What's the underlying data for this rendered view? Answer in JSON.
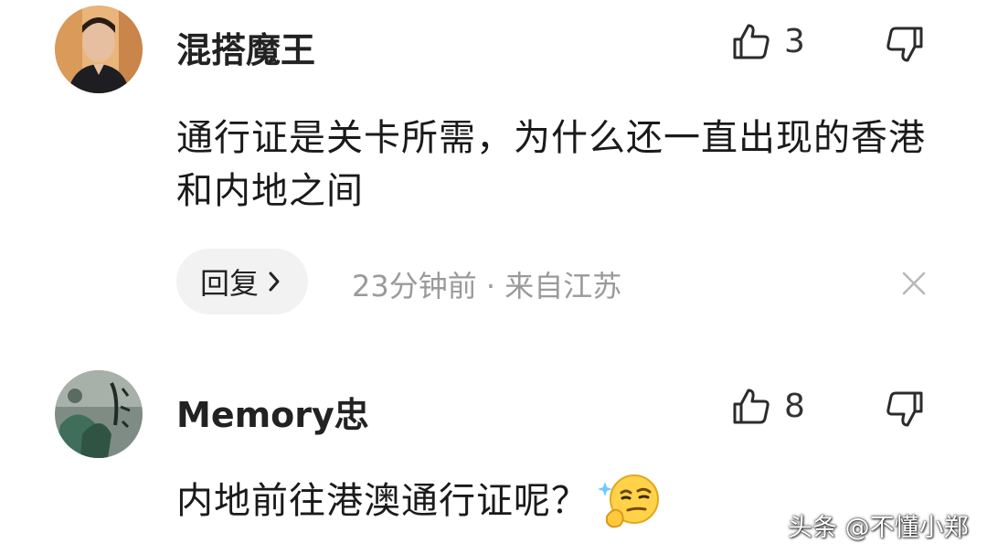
{
  "comments": [
    {
      "username": "混搭魔王",
      "like_count": "3",
      "text": "通行证是关卡所需，为什么还一直出现的香港和内地之间",
      "reply_label": "回复",
      "meta": "23分钟前 · 来自江苏",
      "avatar": "user-avatar-man"
    },
    {
      "username": "Memory忠",
      "like_count": "8",
      "text": "内地前往港澳通行证呢？",
      "emoji": "thinking-smirk-emoji",
      "avatar": "user-avatar-artwork"
    }
  ],
  "watermark": "头条 @不懂小郑",
  "icons": {
    "like": "thumbs-up-icon",
    "dislike": "thumbs-down-icon",
    "reply_chevron": "chevron-right-icon",
    "close": "close-icon"
  },
  "colors": {
    "meta_text": "#9a9a9a",
    "reply_bg": "#f2f2f2",
    "text": "#1a1a1a"
  }
}
